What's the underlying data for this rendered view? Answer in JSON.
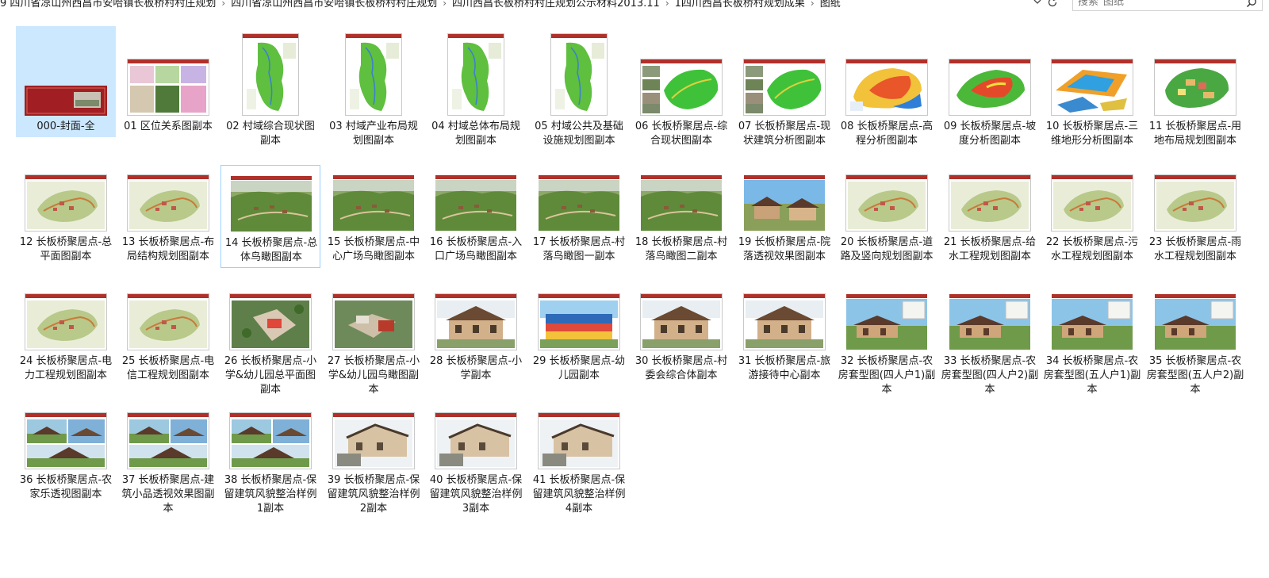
{
  "address_bar": {
    "crumbs": [
      "9 四川省凉山州西昌市安哈镇长板桥村村庄规划",
      "四川省凉山州西昌市安哈镇长板桥村村庄规划",
      "四川西昌长板桥村村庄规划公示材料2013.11",
      "1四川西昌长板桥村规划成果",
      "图纸"
    ],
    "separator": "›",
    "dropdown_icon": "chevron-down-icon",
    "refresh_icon": "refresh-icon"
  },
  "search": {
    "placeholder": "搜索\"图纸\"",
    "icon": "search-icon"
  },
  "files": [
    {
      "name": "000-封面-全",
      "thumb": "cover",
      "selected": true
    },
    {
      "name": "01 区位关系图副本",
      "thumb": "collage"
    },
    {
      "name": "02 村域综合现状图副本",
      "thumb": "portrait-map"
    },
    {
      "name": "03 村域产业布局规划图副本",
      "thumb": "portrait-map"
    },
    {
      "name": "04 村域总体布局规划图副本",
      "thumb": "portrait-map"
    },
    {
      "name": "05 村域公共及基础设施规划图副本",
      "thumb": "portrait-map"
    },
    {
      "name": "06 长板桥聚居点-综合现状图副本",
      "thumb": "green-map"
    },
    {
      "name": "07 长板桥聚居点-现状建筑分析图副本",
      "thumb": "green-map"
    },
    {
      "name": "08 长板桥聚居点-高程分析图副本",
      "thumb": "elevation"
    },
    {
      "name": "09 长板桥聚居点-坡度分析图副本",
      "thumb": "slope"
    },
    {
      "name": "10 长板桥聚居点-三维地形分析图副本",
      "thumb": "terrain3d"
    },
    {
      "name": "11 长板桥聚居点-用地布局规划图副本",
      "thumb": "landuse"
    },
    {
      "name": "12 长板桥聚居点-总平面图副本",
      "thumb": "plan"
    },
    {
      "name": "13 长板桥聚居点-布局结构规划图副本",
      "thumb": "plan"
    },
    {
      "name": "14 长板桥聚居点-总体鸟瞰图副本",
      "thumb": "aerial",
      "hovered": true
    },
    {
      "name": "15 长板桥聚居点-中心广场鸟瞰图副本",
      "thumb": "aerial"
    },
    {
      "name": "16 长板桥聚居点-入口广场鸟瞰图副本",
      "thumb": "aerial"
    },
    {
      "name": "17 长板桥聚居点-村落鸟瞰图一副本",
      "thumb": "aerial"
    },
    {
      "name": "18 长板桥聚居点-村落鸟瞰图二副本",
      "thumb": "aerial"
    },
    {
      "name": "19 长板桥聚居点-院落透视效果图副本",
      "thumb": "courtyard"
    },
    {
      "name": "20 长板桥聚居点-道路及竖向规划图副本",
      "thumb": "plan"
    },
    {
      "name": "21 长板桥聚居点-给水工程规划图副本",
      "thumb": "plan"
    },
    {
      "name": "22 长板桥聚居点-污水工程规划图副本",
      "thumb": "plan"
    },
    {
      "name": "23 长板桥聚居点-雨水工程规划图副本",
      "thumb": "plan"
    },
    {
      "name": "24 长板桥聚居点-电力工程规划图副本",
      "thumb": "plan"
    },
    {
      "name": "25 长板桥聚居点-电信工程规划图副本",
      "thumb": "plan"
    },
    {
      "name": "26 长板桥聚居点-小学&幼儿园总平面图副本",
      "thumb": "school-plan"
    },
    {
      "name": "27 长板桥聚居点-小学&幼儿园鸟瞰图副本",
      "thumb": "school-aerial"
    },
    {
      "name": "28 长板桥聚居点-小学副本",
      "thumb": "building"
    },
    {
      "name": "29 长板桥聚居点-幼儿园副本",
      "thumb": "kindergarten"
    },
    {
      "name": "30 长板桥聚居点-村委会综合体副本",
      "thumb": "building"
    },
    {
      "name": "31 长板桥聚居点-旅游接待中心副本",
      "thumb": "building"
    },
    {
      "name": "32 长板桥聚居点-农房套型图(四人户1)副本",
      "thumb": "house"
    },
    {
      "name": "33 长板桥聚居点-农房套型图(四人户2)副本",
      "thumb": "house"
    },
    {
      "name": "34 长板桥聚居点-农房套型图(五人户1)副本",
      "thumb": "house"
    },
    {
      "name": "35 长板桥聚居点-农房套型图(五人户2)副本",
      "thumb": "house"
    },
    {
      "name": "36 长板桥聚居点-农家乐透视图副本",
      "thumb": "collage-house"
    },
    {
      "name": "37 长板桥聚居点-建筑小品透视效果图副本",
      "thumb": "collage-house"
    },
    {
      "name": "38 长板桥聚居点-保留建筑风貌整治样例1副本",
      "thumb": "collage-house"
    },
    {
      "name": "39 长板桥聚居点-保留建筑风貌整治样例2副本",
      "thumb": "renovation"
    },
    {
      "name": "40 长板桥聚居点-保留建筑风貌整治样例3副本",
      "thumb": "renovation"
    },
    {
      "name": "41 长板桥聚居点-保留建筑风貌整治样例4副本",
      "thumb": "renovation"
    }
  ],
  "colors": {
    "selection": "#cce8ff",
    "hover_border": "#99d1ff",
    "sheet_header": "#b0302a",
    "cover_red": "#a11e22"
  }
}
